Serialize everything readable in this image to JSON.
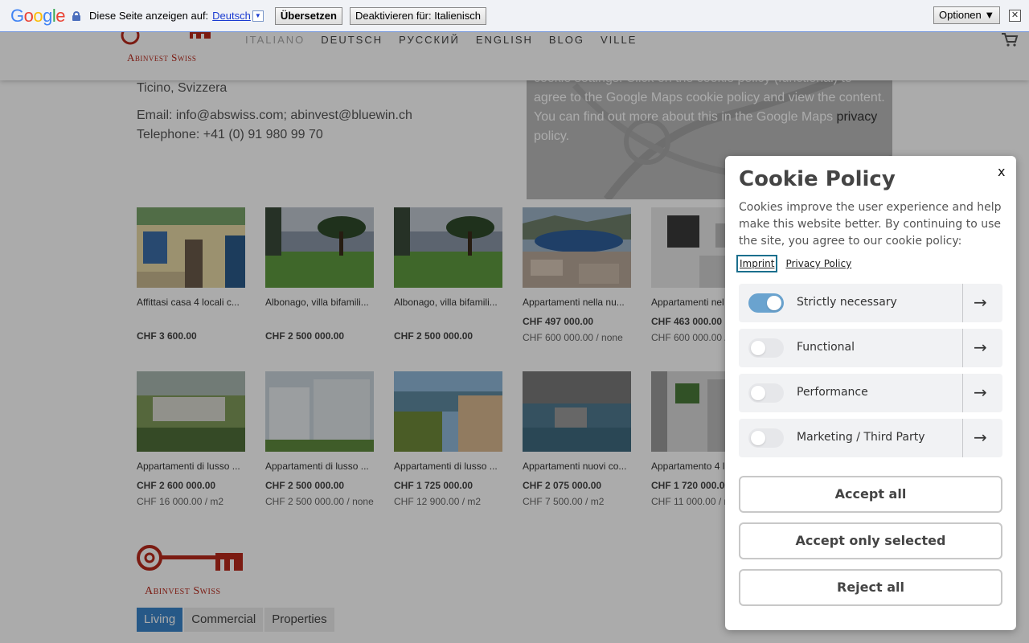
{
  "translate_bar": {
    "logo": "Google",
    "prompt": "Diese Seite anzeigen auf:",
    "language": "Deutsch",
    "dropdown_glyph": "▼",
    "translate_label": "Übersetzen",
    "disable_label": "Deaktivieren für: Italienisch",
    "options_label": "Optionen ▼",
    "close_glyph": "✕"
  },
  "header": {
    "logo_text": "Abinvest Swiss",
    "nav": [
      "ITALIANO",
      "DEUTSCH",
      "РУССКИЙ",
      "ENGLISH",
      "BLOG",
      "VILLE"
    ],
    "brand_color": "#b8291c"
  },
  "contact": {
    "region": "Ticino, Svizzera",
    "email": "Email: info@abswiss.com; abinvest@bluewin.ch",
    "phone": "Telephone: +41 (0) 91 980 99 70"
  },
  "map_notice": {
    "text_part1": "cookie settings. Click on the cookie policy (functional) to agree to the Google Maps cookie policy and view the content. You can find out more about this in the Google Maps ",
    "link": "privacy",
    "text_part2": " policy."
  },
  "listings": [
    {
      "title": "Affittasi casa 4 locali c...",
      "price": "CHF 3 600.00",
      "sub": ""
    },
    {
      "title": "Albonago, villa bifamili...",
      "price": "CHF 2 500 000.00",
      "sub": ""
    },
    {
      "title": "Albonago, villa bifamili...",
      "price": "CHF 2 500 000.00",
      "sub": ""
    },
    {
      "title": "Appartamenti nella nu...",
      "price": "CHF 497 000.00",
      "sub": "CHF 600 000.00 / none"
    },
    {
      "title": "Appartamenti nel",
      "price": "CHF 463 000.00",
      "sub": "CHF 600 000.00 /"
    },
    {
      "title": "Appartamenti di lusso ...",
      "price": "CHF 2 600 000.00",
      "sub": "CHF 16 000.00 / m2"
    },
    {
      "title": "Appartamenti di lusso ...",
      "price": "CHF 2 500 000.00",
      "sub": "CHF 2 500 000.00 / none"
    },
    {
      "title": "Appartamenti di lusso ...",
      "price": "CHF 1 725 000.00",
      "sub": "CHF 12 900.00 / m2"
    },
    {
      "title": "Appartamenti nuovi co...",
      "price": "CHF 2 075 000.00",
      "sub": "CHF 7 500.00 / m2"
    },
    {
      "title": "Appartamento 4 l",
      "price": "CHF 1 720 000.00",
      "sub": "CHF 11 000.00 / m"
    }
  ],
  "footer": {
    "logo_text": "Abinvest Swiss",
    "tabs": [
      "Living",
      "Commercial",
      "Properties"
    ],
    "active_tab_color": "#3a83c9"
  },
  "cookie_modal": {
    "close_label": "x",
    "title": "Cookie Policy",
    "description": "Cookies improve the user experience and help make this website better. By continuing to use the site, you agree to our cookie policy:",
    "imprint_link": "Imprint",
    "privacy_link": "Privacy Policy",
    "options": [
      {
        "label": "Strictly necessary",
        "enabled": true
      },
      {
        "label": "Functional",
        "enabled": false
      },
      {
        "label": "Performance",
        "enabled": false
      },
      {
        "label": "Marketing / Third Party",
        "enabled": false
      }
    ],
    "arrow_glyph": "→",
    "accept_all": "Accept all",
    "accept_selected": "Accept only selected",
    "reject_all": "Reject all",
    "toggle_on_color": "#6aa3cf"
  }
}
